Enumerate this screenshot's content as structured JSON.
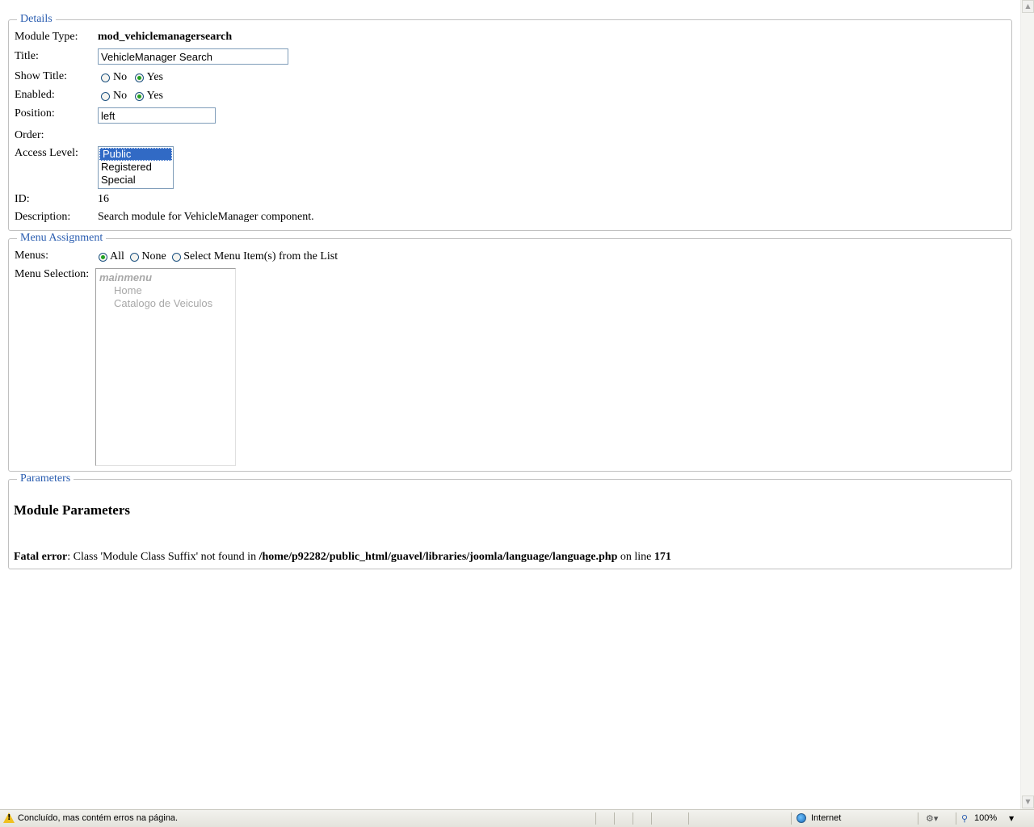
{
  "details": {
    "legend": "Details",
    "module_type_label": "Module Type:",
    "module_type_value": "mod_vehiclemanagersearch",
    "title_label": "Title:",
    "title_value": "VehicleManager Search",
    "show_title_label": "Show Title:",
    "show_title_options": [
      "No",
      "Yes"
    ],
    "show_title_selected": "Yes",
    "enabled_label": "Enabled:",
    "enabled_options": [
      "No",
      "Yes"
    ],
    "enabled_selected": "Yes",
    "position_label": "Position:",
    "position_value": "left",
    "order_label": "Order:",
    "access_label": "Access Level:",
    "access_options": [
      "Public",
      "Registered",
      "Special"
    ],
    "access_selected": "Public",
    "id_label": "ID:",
    "id_value": "16",
    "description_label": "Description:",
    "description_value": "Search module for VehicleManager component."
  },
  "menu_assignment": {
    "legend": "Menu Assignment",
    "menus_label": "Menus:",
    "menus_options": [
      "All",
      "None",
      "Select Menu Item(s) from the List"
    ],
    "menus_selected": "All",
    "menu_selection_label": "Menu Selection:",
    "menu_group": "mainmenu",
    "menu_items": [
      "Home",
      "Catalogo de Veiculos"
    ]
  },
  "parameters": {
    "legend": "Parameters",
    "heading": "Module Parameters",
    "error_prefix": "Fatal error",
    "error_text_1": ": Class 'Module Class Suffix' not found in ",
    "error_path": "/home/p92282/public_html/guavel/libraries/joomla/language/language.php",
    "error_text_2": " on line ",
    "error_line": "171"
  },
  "statusbar": {
    "message": "Concluído, mas contém erros na página.",
    "zone": "Internet",
    "zoom": "100%",
    "icons": [
      "warning-icon",
      "globe-icon",
      "security-icon",
      "zoom-icon"
    ]
  }
}
